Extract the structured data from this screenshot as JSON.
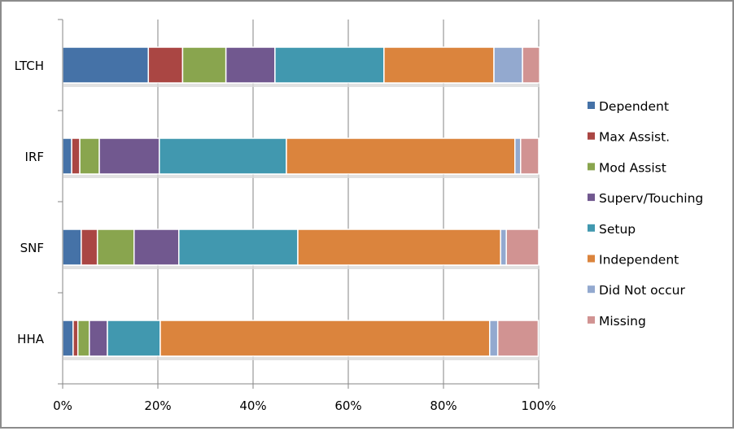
{
  "chart_data": {
    "type": "bar",
    "orientation": "horizontal",
    "stacked": "percent",
    "title": "",
    "xlabel": "",
    "ylabel": "",
    "xlim": [
      0,
      100
    ],
    "x_ticks": [
      "0%",
      "20%",
      "40%",
      "60%",
      "80%",
      "100%"
    ],
    "grid": "vertical",
    "legend_position": "right",
    "categories": [
      "LTCH",
      "IRF",
      "SNF",
      "HHA"
    ],
    "series": [
      {
        "name": "Dependent",
        "color": "#4572a7",
        "values": [
          18.0,
          1.9,
          3.9,
          2.2
        ]
      },
      {
        "name": "Max Assist.",
        "color": "#aa4643",
        "values": [
          7.2,
          1.7,
          3.4,
          1.0
        ]
      },
      {
        "name": "Mod Assist",
        "color": "#89a54e",
        "values": [
          9.1,
          4.1,
          7.7,
          2.4
        ]
      },
      {
        "name": "Superv/Touching",
        "color": "#71588f",
        "values": [
          10.3,
          12.6,
          9.4,
          3.8
        ]
      },
      {
        "name": "Setup",
        "color": "#4198af",
        "values": [
          22.9,
          26.7,
          25.0,
          11.1
        ]
      },
      {
        "name": "Independent",
        "color": "#db843d",
        "values": [
          23.1,
          48.0,
          42.6,
          69.2
        ]
      },
      {
        "name": "Did Not occur",
        "color": "#93a9cf",
        "values": [
          6.0,
          1.2,
          1.2,
          1.7
        ]
      },
      {
        "name": "Missing",
        "color": "#d19392",
        "values": [
          3.6,
          3.8,
          6.8,
          8.5
        ]
      }
    ]
  }
}
